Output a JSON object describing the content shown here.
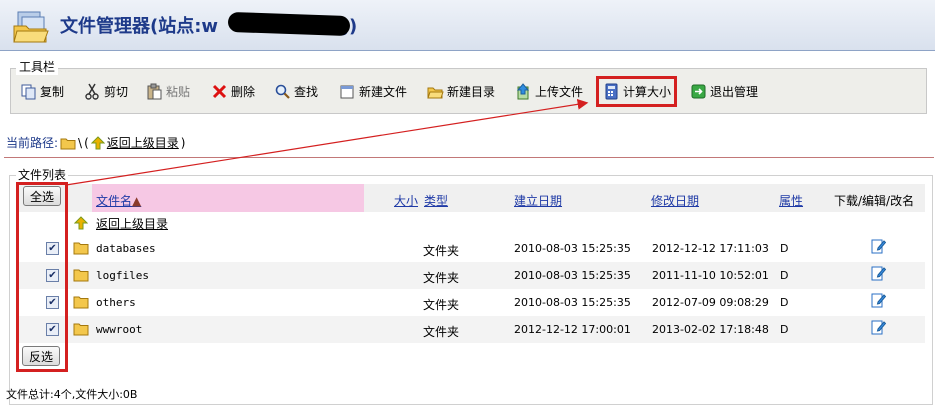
{
  "header": {
    "title": "文件管理器(站点:w",
    "title_end": "g)"
  },
  "toolbar": {
    "legend": "工具栏",
    "buttons": [
      {
        "label": "复制",
        "icon": "copy-icon"
      },
      {
        "label": "剪切",
        "icon": "scissors-icon"
      },
      {
        "label": "粘贴",
        "icon": "paste-icon"
      },
      {
        "label": "删除",
        "icon": "delete-icon"
      },
      {
        "label": "查找",
        "icon": "search-icon"
      },
      {
        "label": "新建文件",
        "icon": "new-file-icon"
      },
      {
        "label": "新建目录",
        "icon": "new-folder-icon"
      },
      {
        "label": "上传文件",
        "icon": "upload-icon"
      },
      {
        "label": "计算大小",
        "icon": "calculator-icon"
      },
      {
        "label": "退出管理",
        "icon": "exit-icon"
      }
    ]
  },
  "path": {
    "label": "当前路径:",
    "current": "\\",
    "open_paren": "(",
    "up_link": "返回上级目录",
    "close_paren": ")"
  },
  "file_list": {
    "legend": "文件列表",
    "select_all": "全选",
    "invert_select": "反选",
    "columns": {
      "name": "文件名",
      "size": "大小",
      "type": "类型",
      "created": "建立日期",
      "modified": "修改日期",
      "attr": "属性",
      "actions": "下载/编辑/改名"
    },
    "up_row": "返回上级目录",
    "rows": [
      {
        "name": "databases",
        "type": "文件夹",
        "created": "2010-08-03 15:25:35",
        "modified": "2012-12-12 17:11:03",
        "attr": "D",
        "checked": true
      },
      {
        "name": "logfiles",
        "type": "文件夹",
        "created": "2010-08-03 15:25:35",
        "modified": "2011-11-10 10:52:01",
        "attr": "D",
        "checked": true
      },
      {
        "name": "others",
        "type": "文件夹",
        "created": "2010-08-03 15:25:35",
        "modified": "2012-07-09 09:08:29",
        "attr": "D",
        "checked": true
      },
      {
        "name": "wwwroot",
        "type": "文件夹",
        "created": "2012-12-12 17:00:01",
        "modified": "2013-02-02 17:18:48",
        "attr": "D",
        "checked": true
      }
    ],
    "summary": "文件总计:4个,文件大小:0B"
  },
  "colors": {
    "title": "#1e3a8a",
    "highlight": "#d42020",
    "sort_header": "#f6c8e4",
    "link": "#1f3aa6"
  }
}
